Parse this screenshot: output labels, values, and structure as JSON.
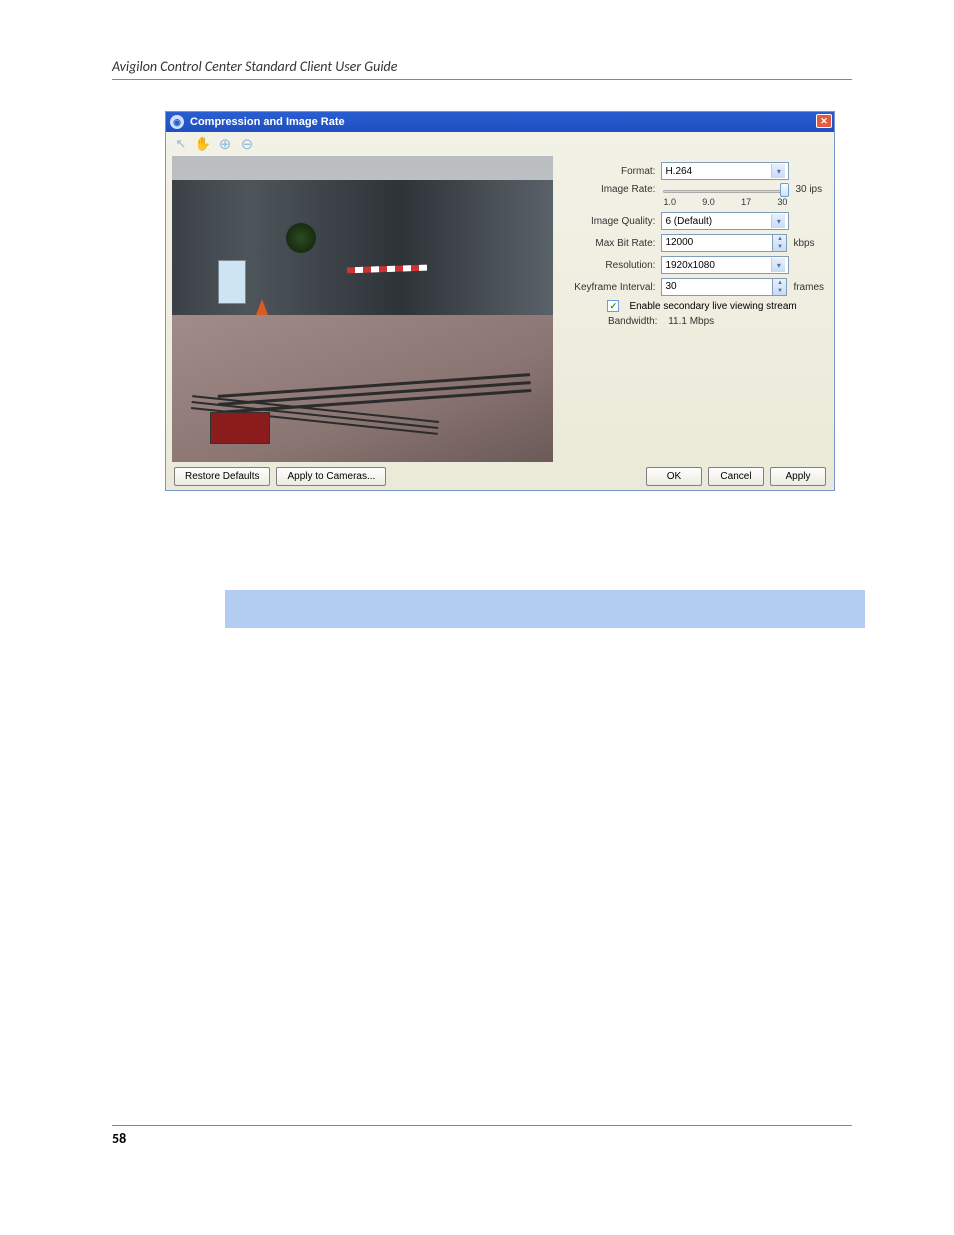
{
  "header": "Avigilon Control Center Standard Client User Guide",
  "page_number": "58",
  "dialog": {
    "title": "Compression and Image Rate",
    "fields": {
      "format": {
        "label": "Format:",
        "value": "H.264"
      },
      "image_rate": {
        "label": "Image Rate:",
        "ticks": [
          "1.0",
          "9.0",
          "17",
          "30"
        ],
        "readout": "30 ips"
      },
      "image_quality": {
        "label": "Image Quality:",
        "value": "6 (Default)"
      },
      "max_bit_rate": {
        "label": "Max Bit Rate:",
        "value": "12000",
        "unit": "kbps"
      },
      "resolution": {
        "label": "Resolution:",
        "value": "1920x1080"
      },
      "keyframe_interval": {
        "label": "Keyframe Interval:",
        "value": "30",
        "unit": "frames"
      },
      "secondary_stream": {
        "checked": true,
        "label": "Enable secondary live viewing stream"
      },
      "bandwidth": {
        "label": "Bandwidth:",
        "value": "11.1 Mbps"
      }
    },
    "buttons": {
      "restore": "Restore Defaults",
      "apply_cameras": "Apply to Cameras...",
      "ok": "OK",
      "cancel": "Cancel",
      "apply": "Apply"
    }
  }
}
